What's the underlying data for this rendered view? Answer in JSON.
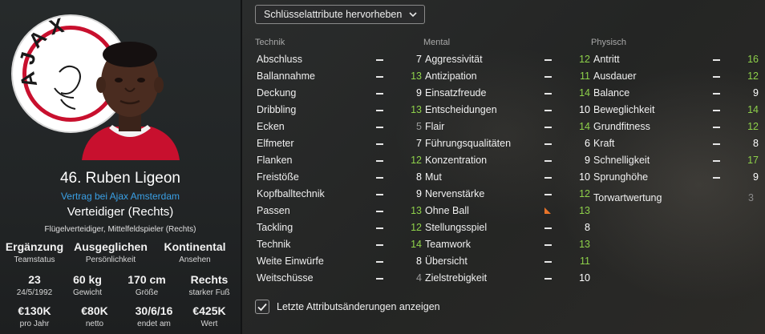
{
  "player": {
    "name": "46. Ruben Ligeon",
    "contract": "Vertrag bei Ajax Amsterdam",
    "position": "Verteidiger (Rechts)",
    "sub_positions": "Flügelverteidiger, Mittelfeldspieler (Rechts)"
  },
  "club_logo": {
    "text": "AJAX",
    "color": "#c8102e"
  },
  "info_rows": [
    [
      {
        "value": "Ergänzung",
        "label": "Teamstatus"
      },
      {
        "value": "Ausgeglichen",
        "label": "Persönlichkeit"
      },
      {
        "value": "Kontinental",
        "label": "Ansehen"
      }
    ],
    [
      {
        "value": "23",
        "label": "24/5/1992"
      },
      {
        "value": "60 kg",
        "label": "Gewicht"
      },
      {
        "value": "170 cm",
        "label": "Größe"
      },
      {
        "value": "Rechts",
        "label": "starker Fuß"
      }
    ],
    [
      {
        "value": "€130K",
        "label": "pro Jahr"
      },
      {
        "value": "€80K",
        "label": "netto"
      },
      {
        "value": "30/6/16",
        "label": "endet am"
      },
      {
        "value": "€425K",
        "label": "Wert"
      }
    ]
  ],
  "highlight_dropdown": {
    "label": "Schlüsselattribute hervorheben",
    "icon": "chevron-down-icon"
  },
  "columns": [
    {
      "title": "Technik",
      "attributes": [
        {
          "name": "Abschluss",
          "value": "7",
          "color": "#ffffff"
        },
        {
          "name": "Ballannahme",
          "value": "13",
          "color": "#8ed14a"
        },
        {
          "name": "Deckung",
          "value": "9",
          "color": "#ffffff"
        },
        {
          "name": "Dribbling",
          "value": "13",
          "color": "#8ed14a"
        },
        {
          "name": "Ecken",
          "value": "5",
          "color": "#9a9a9a"
        },
        {
          "name": "Elfmeter",
          "value": "7",
          "color": "#ffffff"
        },
        {
          "name": "Flanken",
          "value": "12",
          "color": "#8ed14a"
        },
        {
          "name": "Freistöße",
          "value": "8",
          "color": "#ffffff"
        },
        {
          "name": "Kopfballtechnik",
          "value": "9",
          "color": "#ffffff"
        },
        {
          "name": "Passen",
          "value": "13",
          "color": "#8ed14a"
        },
        {
          "name": "Tackling",
          "value": "12",
          "color": "#8ed14a"
        },
        {
          "name": "Technik",
          "value": "14",
          "color": "#8ed14a"
        },
        {
          "name": "Weite Einwürfe",
          "value": "8",
          "color": "#ffffff"
        },
        {
          "name": "Weitschüsse",
          "value": "4",
          "color": "#9a9a9a"
        }
      ]
    },
    {
      "title": "Mental",
      "attributes": [
        {
          "name": "Aggressivität",
          "value": "12",
          "color": "#8ed14a"
        },
        {
          "name": "Antizipation",
          "value": "11",
          "color": "#8ed14a"
        },
        {
          "name": "Einsatzfreude",
          "value": "14",
          "color": "#8ed14a"
        },
        {
          "name": "Entscheidungen",
          "value": "10",
          "color": "#ffffff"
        },
        {
          "name": "Flair",
          "value": "14",
          "color": "#8ed14a"
        },
        {
          "name": "Führungsqualitäten",
          "value": "6",
          "color": "#ffffff"
        },
        {
          "name": "Konzentration",
          "value": "9",
          "color": "#ffffff"
        },
        {
          "name": "Mut",
          "value": "10",
          "color": "#ffffff"
        },
        {
          "name": "Nervenstärke",
          "value": "12",
          "color": "#8ed14a"
        },
        {
          "name": "Ohne Ball",
          "value": "13",
          "color": "#8ed14a",
          "change": "increase"
        },
        {
          "name": "Stellungsspiel",
          "value": "8",
          "color": "#ffffff"
        },
        {
          "name": "Teamwork",
          "value": "13",
          "color": "#8ed14a"
        },
        {
          "name": "Übersicht",
          "value": "11",
          "color": "#8ed14a"
        },
        {
          "name": "Zielstrebigkeit",
          "value": "10",
          "color": "#ffffff"
        }
      ]
    },
    {
      "title": "Physisch",
      "attributes": [
        {
          "name": "Antritt",
          "value": "16",
          "color": "#8ed14a"
        },
        {
          "name": "Ausdauer",
          "value": "12",
          "color": "#8ed14a"
        },
        {
          "name": "Balance",
          "value": "9",
          "color": "#ffffff"
        },
        {
          "name": "Beweglichkeit",
          "value": "14",
          "color": "#8ed14a"
        },
        {
          "name": "Grundfitness",
          "value": "12",
          "color": "#8ed14a"
        },
        {
          "name": "Kraft",
          "value": "8",
          "color": "#ffffff"
        },
        {
          "name": "Schnelligkeit",
          "value": "17",
          "color": "#8ed14a"
        },
        {
          "name": "Sprunghöhe",
          "value": "9",
          "color": "#ffffff"
        }
      ]
    }
  ],
  "goalkeeping": {
    "name": "Torwartwertung",
    "value": "3"
  },
  "attribute_changes": {
    "label": "Letzte Attributsänderungen anzeigen",
    "checked": true
  }
}
